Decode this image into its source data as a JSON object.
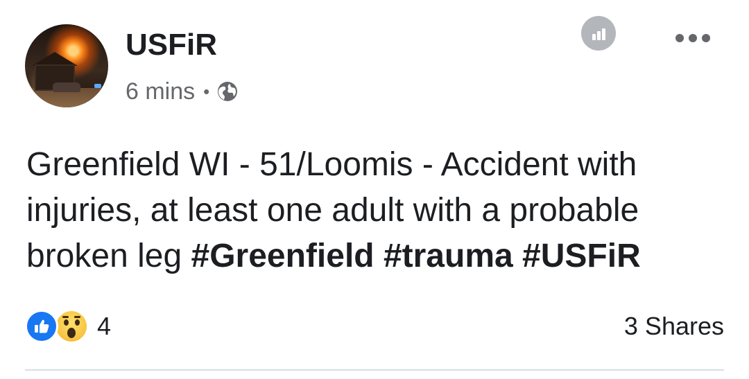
{
  "post": {
    "author": "USFiR",
    "timestamp": "6 mins",
    "separator": "•",
    "privacy_icon": "globe-icon",
    "text_plain": "Greenfield WI - 51/Loomis - Accident with injuries, at least one adult with a probable broken leg ",
    "hashtags": [
      "#Greenfield",
      "#trauma",
      "#USFiR"
    ],
    "reactions": {
      "types": [
        "like",
        "wow"
      ],
      "count": "4"
    },
    "shares_label": "3 Shares"
  },
  "colors": {
    "text": "#1c1e21",
    "secondary": "#65676b",
    "like_blue": "#1877f2",
    "insights_gray": "#b3b6bb"
  },
  "icons": {
    "insights": "insights-bar-chart-icon",
    "more": "more-options-icon",
    "like": "like-reaction-icon",
    "wow": "wow-reaction-icon"
  }
}
